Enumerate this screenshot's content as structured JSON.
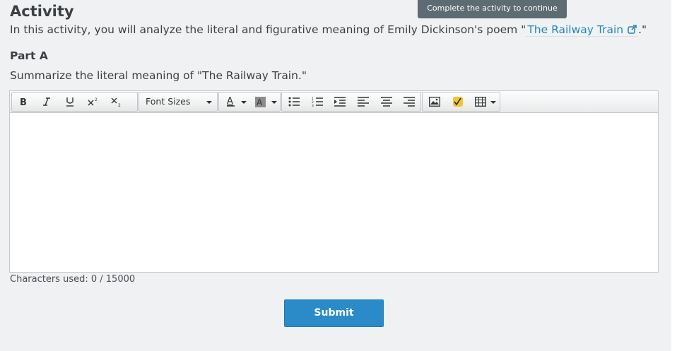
{
  "header": {
    "title": "Activity",
    "tooltip": "Complete the activity to continue"
  },
  "intro": {
    "text_before": "In this activity, you will analyze the literal and figurative meaning of Emily Dickinson's poem \"",
    "link_text": "The Railway Train",
    "text_after": ".\""
  },
  "part": {
    "label": "Part A",
    "question": "Summarize the literal meaning of \"The Railway Train.\""
  },
  "toolbar": {
    "bold_icon": "bold-icon",
    "italic_icon": "italic-icon",
    "underline_icon": "underline-icon",
    "superscript_icon": "superscript-icon",
    "subscript_icon": "subscript-icon",
    "font_sizes_label": "Font Sizes",
    "text_color_icon": "text-color-icon",
    "background_color_icon": "background-color-icon",
    "bullet_list_icon": "bullet-list-icon",
    "numbered_list_icon": "numbered-list-icon",
    "indent_icon": "indent-icon",
    "align_left_icon": "align-left-icon",
    "align_center_icon": "align-center-icon",
    "align_right_icon": "align-right-icon",
    "image_icon": "image-icon",
    "math_icon": "math-icon",
    "table_icon": "table-icon"
  },
  "editor": {
    "content": ""
  },
  "status": {
    "characters_used": "Characters used: 0 / 15000"
  },
  "actions": {
    "submit_label": "Submit"
  },
  "colors": {
    "accent": "#2a8bc8",
    "link": "#2a83b4",
    "tooltip_bg": "#5d6b72",
    "page_bg": "#f0f1f2"
  }
}
